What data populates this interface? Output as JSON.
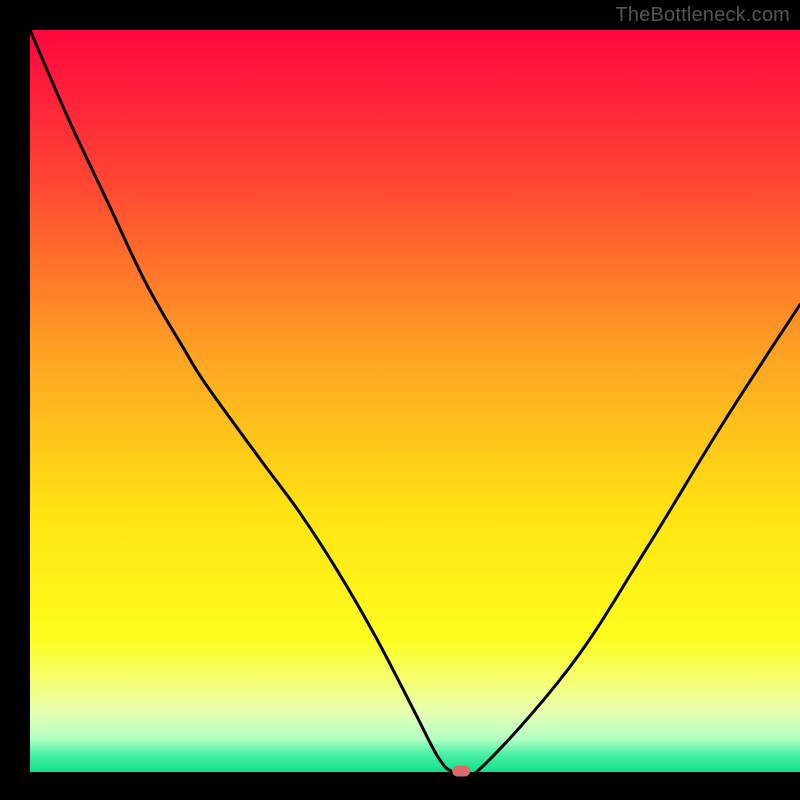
{
  "watermark": "TheBottleneck.com",
  "chart_data": {
    "type": "line",
    "title": "",
    "xlabel": "",
    "ylabel": "",
    "ylim": [
      0,
      100
    ],
    "xlim": [
      0,
      100
    ],
    "x": [
      0,
      5,
      10,
      15,
      20,
      23,
      30,
      35,
      40,
      45,
      50,
      53,
      55,
      58,
      70,
      80,
      90,
      100
    ],
    "values": [
      100,
      88,
      77,
      66,
      57,
      52,
      42,
      35,
      27,
      18,
      8,
      2,
      0,
      0,
      14,
      30,
      47,
      63
    ],
    "minimum_marker": {
      "x": 56,
      "y": 0
    },
    "gradient_stops": [
      {
        "pos": 0.0,
        "color": "#ff063f"
      },
      {
        "pos": 0.2,
        "color": "#ff4433"
      },
      {
        "pos": 0.45,
        "color": "#ffa722"
      },
      {
        "pos": 0.65,
        "color": "#ffe312"
      },
      {
        "pos": 0.82,
        "color": "#fdfd1e"
      },
      {
        "pos": 0.88,
        "color": "#f4ff76"
      },
      {
        "pos": 0.92,
        "color": "#e5ffb1"
      },
      {
        "pos": 0.955,
        "color": "#b4ffc4"
      },
      {
        "pos": 0.975,
        "color": "#4ff0a7"
      },
      {
        "pos": 1.0,
        "color": "#0fe089"
      }
    ]
  }
}
